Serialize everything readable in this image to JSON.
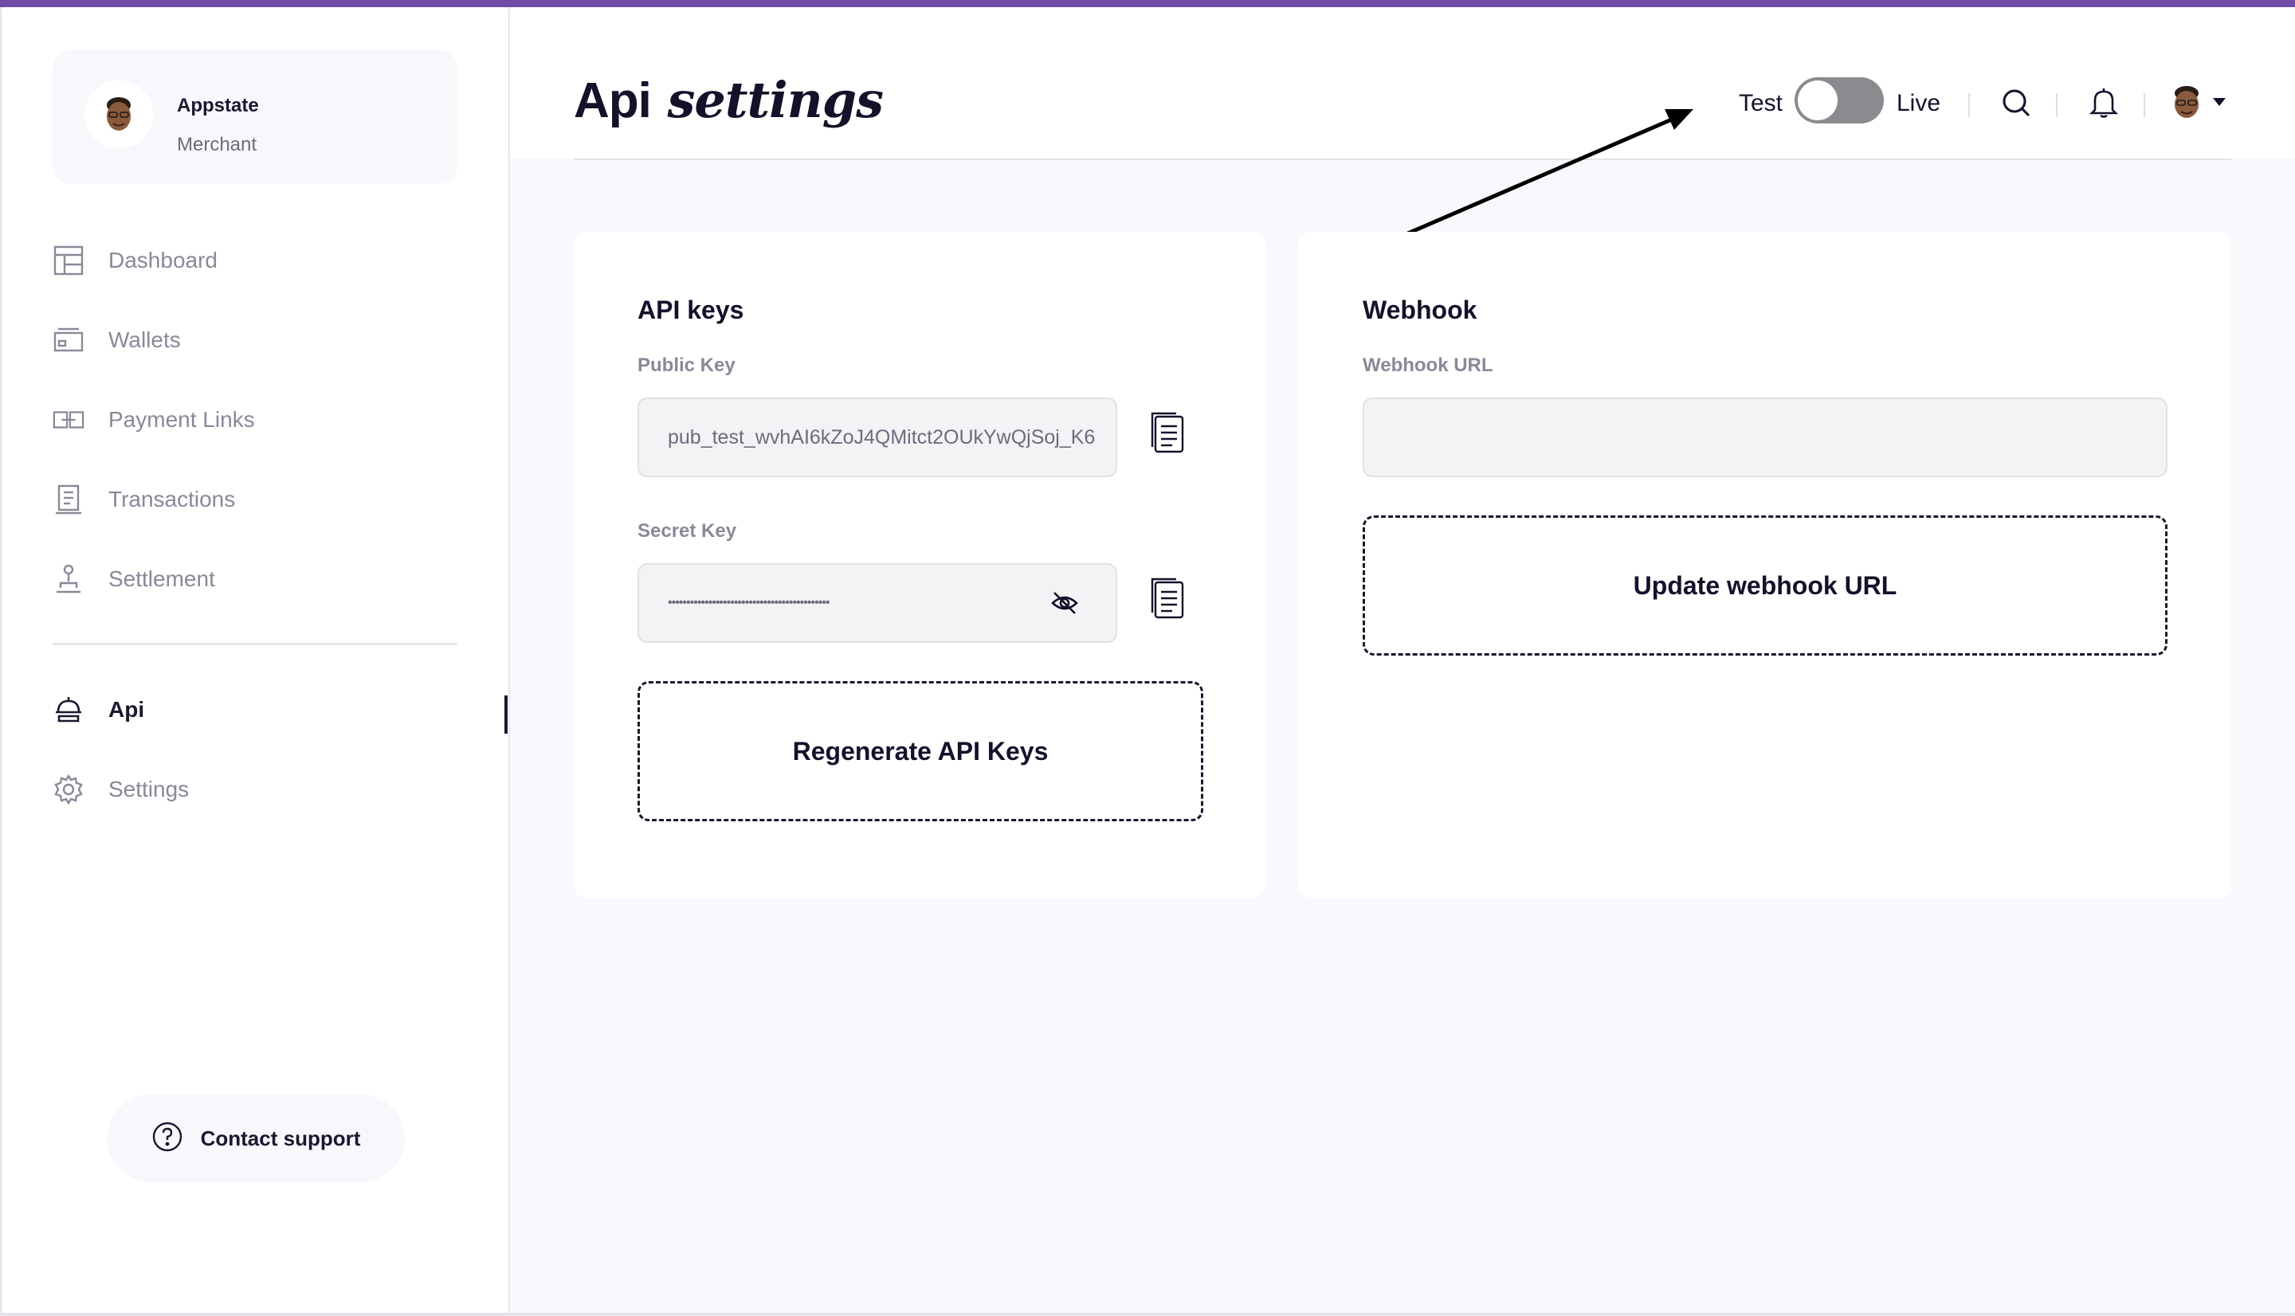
{
  "merchant": {
    "name": "Appstate",
    "role": "Merchant"
  },
  "nav": {
    "items": [
      {
        "label": "Dashboard",
        "icon": "dashboard-icon"
      },
      {
        "label": "Wallets",
        "icon": "wallet-icon"
      },
      {
        "label": "Payment Links",
        "icon": "link-icon"
      },
      {
        "label": "Transactions",
        "icon": "receipt-icon"
      },
      {
        "label": "Settlement",
        "icon": "stamp-icon"
      }
    ],
    "secondary": [
      {
        "label": "Api",
        "icon": "api-icon",
        "active": true
      },
      {
        "label": "Settings",
        "icon": "gear-icon"
      }
    ]
  },
  "support": {
    "label": "Contact support"
  },
  "header": {
    "title_part1": "Api",
    "title_part2": "settings",
    "mode_test": "Test",
    "mode_live": "Live",
    "mode_toggle_live": false
  },
  "api_keys": {
    "title": "API keys",
    "public_key_label": "Public Key",
    "public_key_value": "pub_test_wvhAI6kZoJ4QMitct2OUkYwQjSoj_K6",
    "secret_key_label": "Secret Key",
    "secret_key_masked": "••••••••••••••••••••••••••••••••••••••••••••",
    "regenerate_label": "Regenerate API Keys"
  },
  "webhook": {
    "title": "Webhook",
    "url_label": "Webhook URL",
    "url_value": "",
    "update_label": "Update webhook URL"
  },
  "colors": {
    "accent": "#6f4ca8",
    "text_dark": "#14112b",
    "muted": "#8a8898",
    "toggle_off": "#8a8a8f",
    "background": "#f9f9fd"
  }
}
